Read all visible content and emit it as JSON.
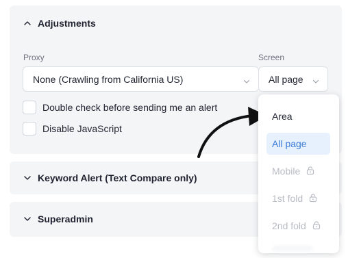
{
  "adjustments": {
    "title": "Adjustments",
    "proxy": {
      "label": "Proxy",
      "value": "None (Crawling from California US)"
    },
    "screen": {
      "label": "Screen",
      "value": "All page"
    },
    "checkboxes": [
      {
        "label": "Double check before sending me an alert",
        "checked": false
      },
      {
        "label": "Disable JavaScript",
        "checked": false
      }
    ]
  },
  "screen_dropdown": {
    "options": [
      {
        "label": "Area",
        "state": "enabled"
      },
      {
        "label": "All page",
        "state": "selected"
      },
      {
        "label": "Mobile",
        "state": "locked"
      },
      {
        "label": "1st fold",
        "state": "locked"
      },
      {
        "label": "2nd fold",
        "state": "locked"
      }
    ]
  },
  "sections": {
    "keyword_alert": {
      "title": "Keyword Alert (Text Compare only)"
    },
    "superadmin": {
      "title": "Superadmin"
    }
  },
  "colors": {
    "panel_bg": "#f4f5f7",
    "selected_bg": "#e7f0fd",
    "selected_text": "#3b7bd8",
    "disabled_text": "#b9bcc4"
  }
}
